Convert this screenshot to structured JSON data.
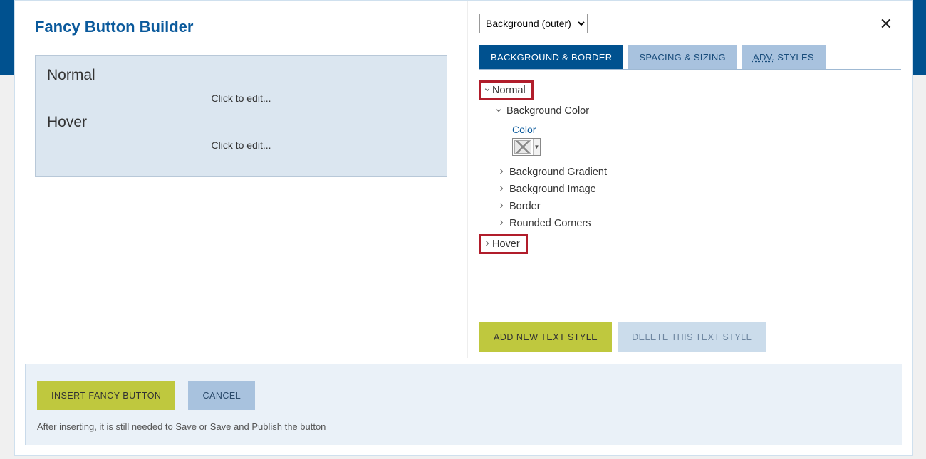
{
  "header": {
    "title": "Fancy Button Builder"
  },
  "preview": {
    "normal_heading": "Normal",
    "normal_edit": "Click to edit...",
    "hover_heading": "Hover",
    "hover_edit": "Click to edit..."
  },
  "right": {
    "layer_select_value": "Background (outer)",
    "tabs": {
      "bg": "BACKGROUND & BORDER",
      "spacing": "SPACING & SIZING",
      "adv_prefix": "ADV.",
      "adv_suffix": " STYLES"
    },
    "tree": {
      "normal": "Normal",
      "bg_color": "Background Color",
      "color_label": "Color",
      "bg_gradient": "Background Gradient",
      "bg_image": "Background Image",
      "border": "Border",
      "rounded": "Rounded Corners",
      "hover": "Hover"
    },
    "buttons": {
      "add": "ADD NEW TEXT STYLE",
      "del": "DELETE THIS TEXT STYLE"
    }
  },
  "footer": {
    "insert": "INSERT FANCY BUTTON",
    "cancel": "CANCEL",
    "note": "After inserting, it is still needed to Save or Save and Publish the button"
  },
  "icons": {
    "close": "✕"
  }
}
